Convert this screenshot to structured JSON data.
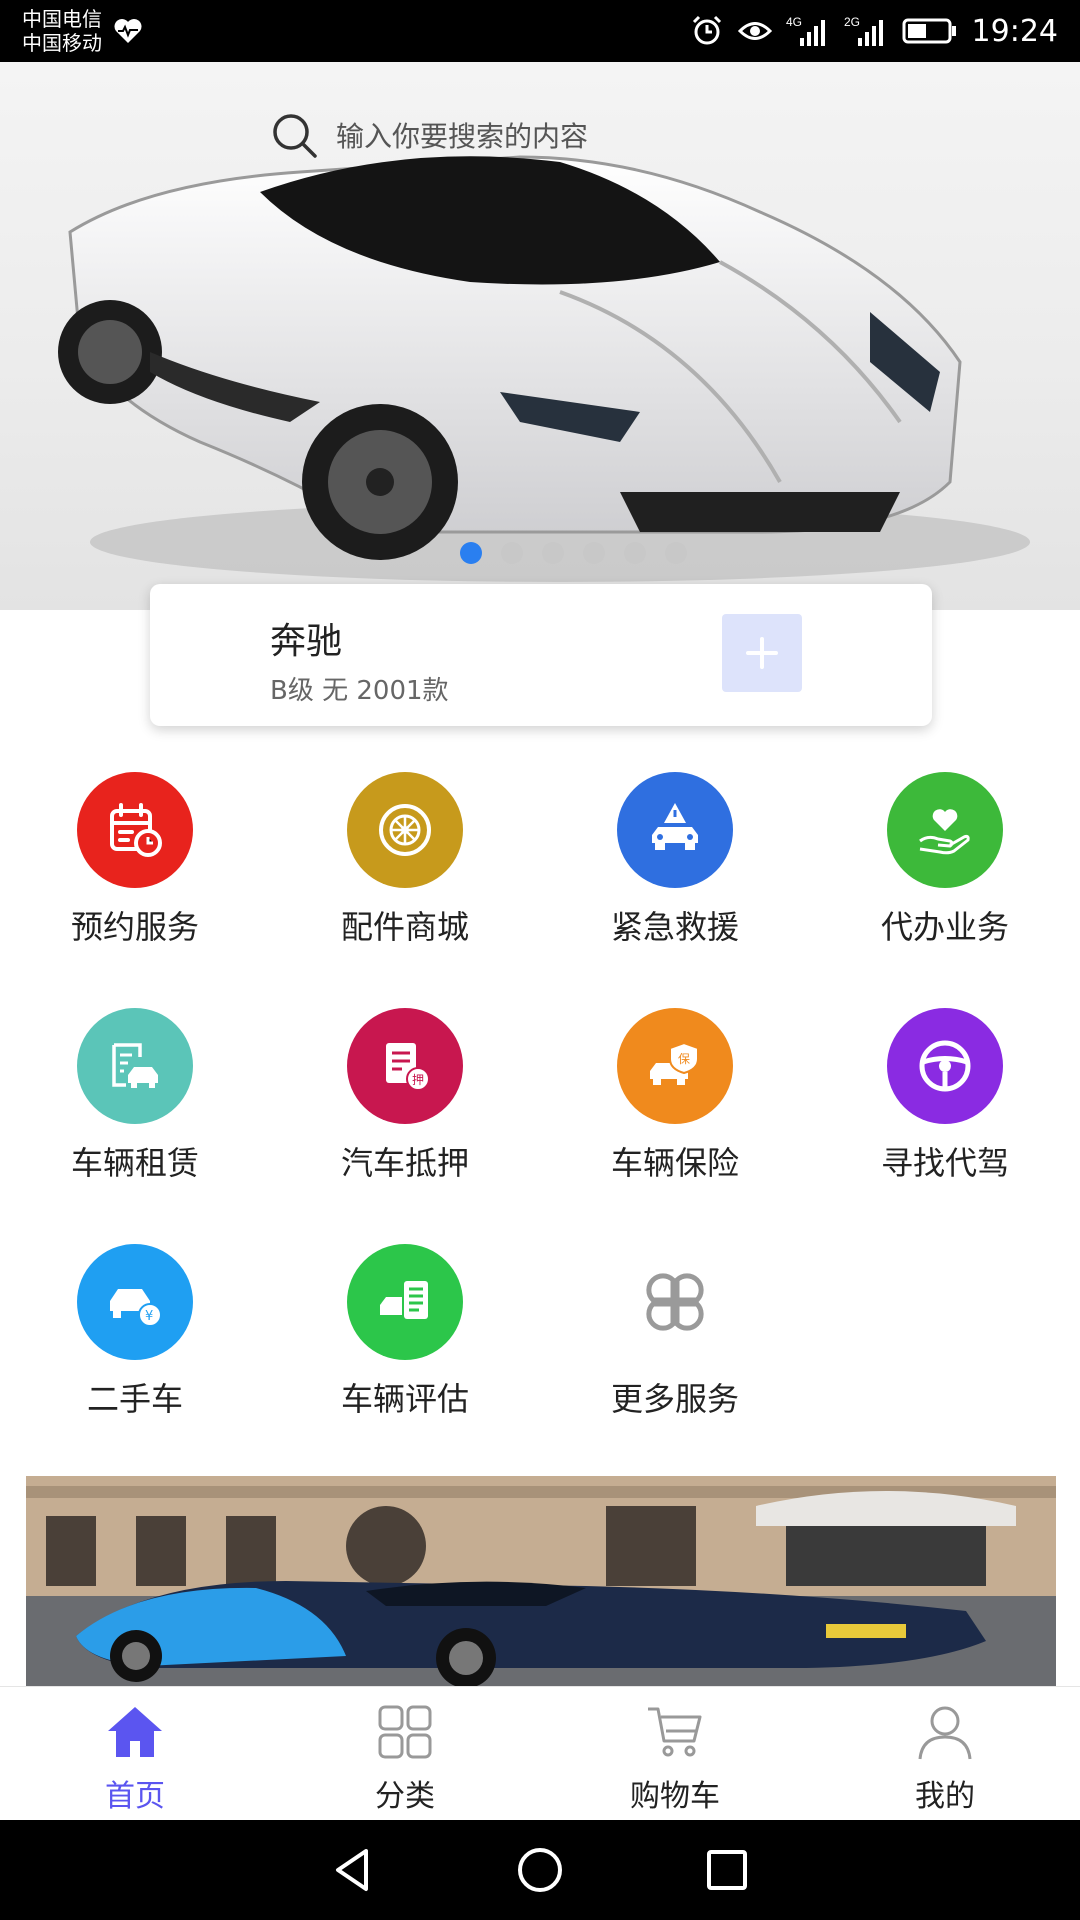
{
  "status_bar": {
    "carrier_1": "中国电信",
    "carrier_2": "中国移动",
    "net_1": "4G",
    "net_2": "2G",
    "time": "19:24",
    "icons": [
      "heart-rate-icon",
      "alarm-icon",
      "eye-icon",
      "signal-icon",
      "battery-icon"
    ]
  },
  "search": {
    "placeholder": "输入你要搜索的内容"
  },
  "carousel": {
    "count": 6,
    "active_index": 0
  },
  "vehicle": {
    "name": "奔驰",
    "desc": "B级 无 2001款",
    "add_icon": "plus-icon"
  },
  "services": [
    {
      "label": "预约服务",
      "icon": "calendar-clock-icon",
      "color": "#e8231d"
    },
    {
      "label": "配件商城",
      "icon": "wheel-icon",
      "color": "#c79a1c"
    },
    {
      "label": "紧急救援",
      "icon": "rescue-car-icon",
      "color": "#2f6fe0"
    },
    {
      "label": "代办业务",
      "icon": "hand-heart-icon",
      "color": "#3db93a"
    },
    {
      "label": "车辆租赁",
      "icon": "rental-car-icon",
      "color": "#5bc5b8"
    },
    {
      "label": "汽车抵押",
      "icon": "mortgage-icon",
      "color": "#c8174f"
    },
    {
      "label": "车辆保险",
      "icon": "insurance-car-icon",
      "color": "#f08a1d"
    },
    {
      "label": "寻找代驾",
      "icon": "steering-wheel-icon",
      "color": "#8a2be2"
    },
    {
      "label": "二手车",
      "icon": "used-car-icon",
      "color": "#1f9ff2"
    },
    {
      "label": "车辆评估",
      "icon": "evaluation-icon",
      "color": "#2cc64a"
    },
    {
      "label": "更多服务",
      "icon": "more-grid-icon",
      "color": "#9a9a9a"
    }
  ],
  "tabs": [
    {
      "label": "首页",
      "icon": "home-icon",
      "active": true
    },
    {
      "label": "分类",
      "icon": "category-icon",
      "active": false
    },
    {
      "label": "购物车",
      "icon": "cart-icon",
      "active": false
    },
    {
      "label": "我的",
      "icon": "user-icon",
      "active": false
    }
  ],
  "colors": {
    "accent": "#5b55f0",
    "dot_active": "#2a7ff0"
  }
}
